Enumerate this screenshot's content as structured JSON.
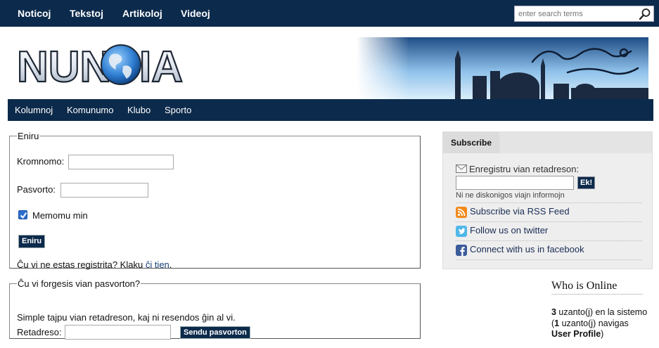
{
  "topnav": {
    "items": [
      {
        "label": "Noticoj"
      },
      {
        "label": "Tekstoj"
      },
      {
        "label": "Artikoloj"
      },
      {
        "label": "Videoj"
      }
    ]
  },
  "search": {
    "placeholder": "enter search terms",
    "icon": "search-icon"
  },
  "header": {
    "logo_text": "NUNOJNIA",
    "banner_icon": "ramadan-banner"
  },
  "secnav": {
    "items": [
      {
        "label": "Kolumnoj"
      },
      {
        "label": "Komunumo"
      },
      {
        "label": "Klubo"
      },
      {
        "label": "Sporto"
      }
    ]
  },
  "login": {
    "legend": "Eniru",
    "username_label": "Kromnomo:",
    "username_value": "",
    "password_label": "Pasvorto:",
    "password_value": "",
    "remember_label": "Memomu min",
    "remember_checked": true,
    "submit_label": "Eniru",
    "register_prefix": "Ĉu vi ne estas registrita? Klaku ",
    "register_link": "ĉi tien",
    "register_suffix": "."
  },
  "forgot": {
    "legend": "Ĉu vi forgesis vian pasvorton?",
    "instructions": "Simple tajpu vian retadreson, kaj ni resendos ĝin al vi.",
    "email_label": "Retadreso:",
    "email_value": "",
    "submit_label": "Sendu pasvorton"
  },
  "subscribe": {
    "tab_label": "Subscribe",
    "email_label": "Enregistru vian retadreson:",
    "email_value": "",
    "button_label": "Ek!",
    "note": "Ni ne diskonigos viajn informojn",
    "links": [
      {
        "label": "Subscribe via RSS Feed",
        "icon": "rss-icon"
      },
      {
        "label": "Follow us on twitter",
        "icon": "twitter-icon"
      },
      {
        "label": "Connect with us in facebook",
        "icon": "facebook-icon"
      }
    ]
  },
  "who_online": {
    "title": "Who is Online",
    "users_count": "3",
    "users_text": " uzanto(j) en la sistemo",
    "browsing_count": "1",
    "browsing_text_pre": "(",
    "browsing_text_post": " uzanto(j) navigas",
    "page_name": "User Profile",
    "page_suffix": ")"
  },
  "colors": {
    "navy": "#0c2a4b",
    "link": "#1a3f7a",
    "box_bg": "#eeeeee"
  }
}
